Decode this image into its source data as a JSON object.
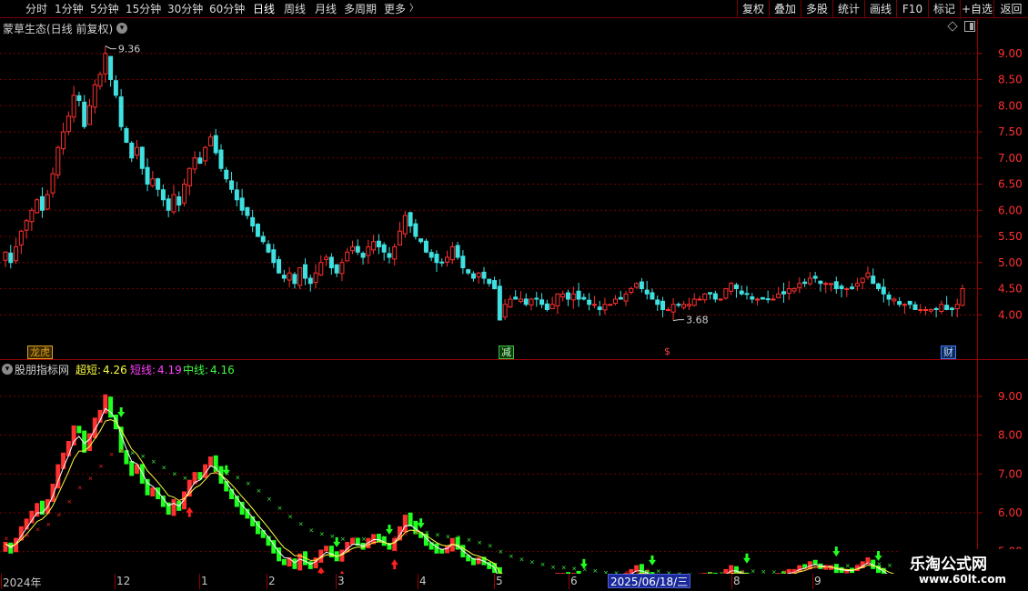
{
  "toolbar": {
    "periods": [
      "分时",
      "1分钟",
      "5分钟",
      "15分钟",
      "30分钟",
      "60分钟",
      "日线",
      "周线",
      "月线",
      "多周期",
      "更多"
    ],
    "active": "日线",
    "more_arrow": "〉",
    "right_buttons": [
      "复权",
      "叠加",
      "多股",
      "统计",
      "画线",
      "F10",
      "标记",
      "+自选",
      "返回"
    ]
  },
  "main_chart": {
    "title": "蒙草生态(日线 前复权)",
    "high_label": "9.36",
    "low_label": "3.68",
    "tags": [
      {
        "text": "龙虎",
        "color": "#e0a020"
      },
      {
        "text": "减",
        "color": "#40c040"
      },
      {
        "text": "$",
        "color": "#ff4040"
      },
      {
        "text": "财",
        "color": "#4080ff"
      }
    ]
  },
  "indicator": {
    "name": "股朋指标网",
    "lines": [
      {
        "label": "超短:",
        "value": "4.26",
        "color": "#ffff40"
      },
      {
        "label": "短线:",
        "value": "4.19",
        "color": "#ff40ff"
      },
      {
        "label": "中线:",
        "value": "4.16",
        "color": "#40ff40"
      }
    ]
  },
  "xaxis": {
    "labels": [
      "2024年",
      "12",
      "1",
      "2",
      "3",
      "4",
      "5",
      "6",
      "8",
      "9"
    ],
    "highlight": "2025/06/18/三"
  },
  "watermark": {
    "title": "乐淘公式网",
    "url": "www.60lt.com"
  },
  "colors": {
    "up": "#ff3030",
    "down": "#40e0e0",
    "grid": "#7a0000",
    "axis": "#ff3030",
    "ma_fast": "#ffffff",
    "ma_mid": "#ffff40",
    "ma_slow": "#40ff40",
    "arrow_up": "#ff2020",
    "arrow_down": "#20ff20"
  },
  "chart_data": [
    {
      "type": "candlestick",
      "title": "蒙草生态(日线 前复权)",
      "ylim": [
        3.5,
        9.5
      ],
      "yticks": [
        4.0,
        4.5,
        5.0,
        5.5,
        6.0,
        6.5,
        7.0,
        7.5,
        8.0,
        8.5,
        9.0
      ],
      "grid": true,
      "close": [
        5.2,
        5.0,
        5.3,
        5.6,
        5.8,
        6.0,
        6.2,
        6.0,
        6.3,
        6.7,
        7.2,
        7.5,
        7.8,
        8.2,
        8.1,
        7.6,
        8.0,
        8.4,
        8.6,
        9.0,
        8.5,
        8.2,
        7.6,
        7.3,
        7.0,
        7.2,
        6.8,
        6.5,
        6.6,
        6.4,
        6.2,
        6.0,
        6.3,
        6.1,
        6.5,
        6.8,
        7.0,
        6.9,
        7.2,
        7.4,
        7.1,
        6.8,
        6.6,
        6.4,
        6.2,
        6.0,
        5.9,
        5.7,
        5.5,
        5.4,
        5.2,
        5.0,
        4.8,
        4.7,
        4.8,
        4.6,
        4.9,
        4.7,
        4.6,
        4.8,
        5.0,
        5.1,
        4.9,
        4.8,
        5.0,
        5.2,
        5.3,
        5.2,
        5.1,
        5.3,
        5.4,
        5.3,
        5.2,
        5.1,
        5.3,
        5.6,
        5.9,
        5.7,
        5.5,
        5.4,
        5.2,
        5.1,
        5.0,
        5.0,
        5.1,
        5.3,
        5.1,
        4.9,
        4.8,
        4.7,
        4.8,
        4.7,
        4.6,
        4.5,
        3.9,
        4.2,
        4.3,
        4.3,
        4.3,
        4.2,
        4.3,
        4.3,
        4.2,
        4.1,
        4.2,
        4.4,
        4.4,
        4.3,
        4.4,
        4.3,
        4.3,
        4.2,
        4.2,
        4.1,
        4.2,
        4.2,
        4.3,
        4.3,
        4.4,
        4.5,
        4.6,
        4.5,
        4.4,
        4.3,
        4.2,
        4.1,
        4.1,
        4.2,
        4.2,
        4.2,
        4.2,
        4.3,
        4.3,
        4.4,
        4.4,
        4.3,
        4.3,
        4.5,
        4.6,
        4.5,
        4.4,
        4.4,
        4.3,
        4.3,
        4.3,
        4.3,
        4.3,
        4.4,
        4.4,
        4.5,
        4.5,
        4.6,
        4.6,
        4.7,
        4.7,
        4.6,
        4.6,
        4.6,
        4.5,
        4.5,
        4.5,
        4.5,
        4.6,
        4.7,
        4.8,
        4.6,
        4.5,
        4.4,
        4.3,
        4.3,
        4.2,
        4.2,
        4.2,
        4.1,
        4.1,
        4.1,
        4.1,
        4.1,
        4.2,
        4.1,
        4.1,
        4.2,
        4.5
      ]
    },
    {
      "type": "line",
      "title": "股朋指标网",
      "ylim": [
        4.5,
        9.7
      ],
      "yticks": [
        5.0,
        6.0,
        7.0,
        8.0,
        9.0
      ],
      "series": [
        {
          "name": "超短",
          "latest": 4.26
        },
        {
          "name": "短线",
          "latest": 4.19
        },
        {
          "name": "中线",
          "latest": 4.16
        }
      ]
    }
  ]
}
